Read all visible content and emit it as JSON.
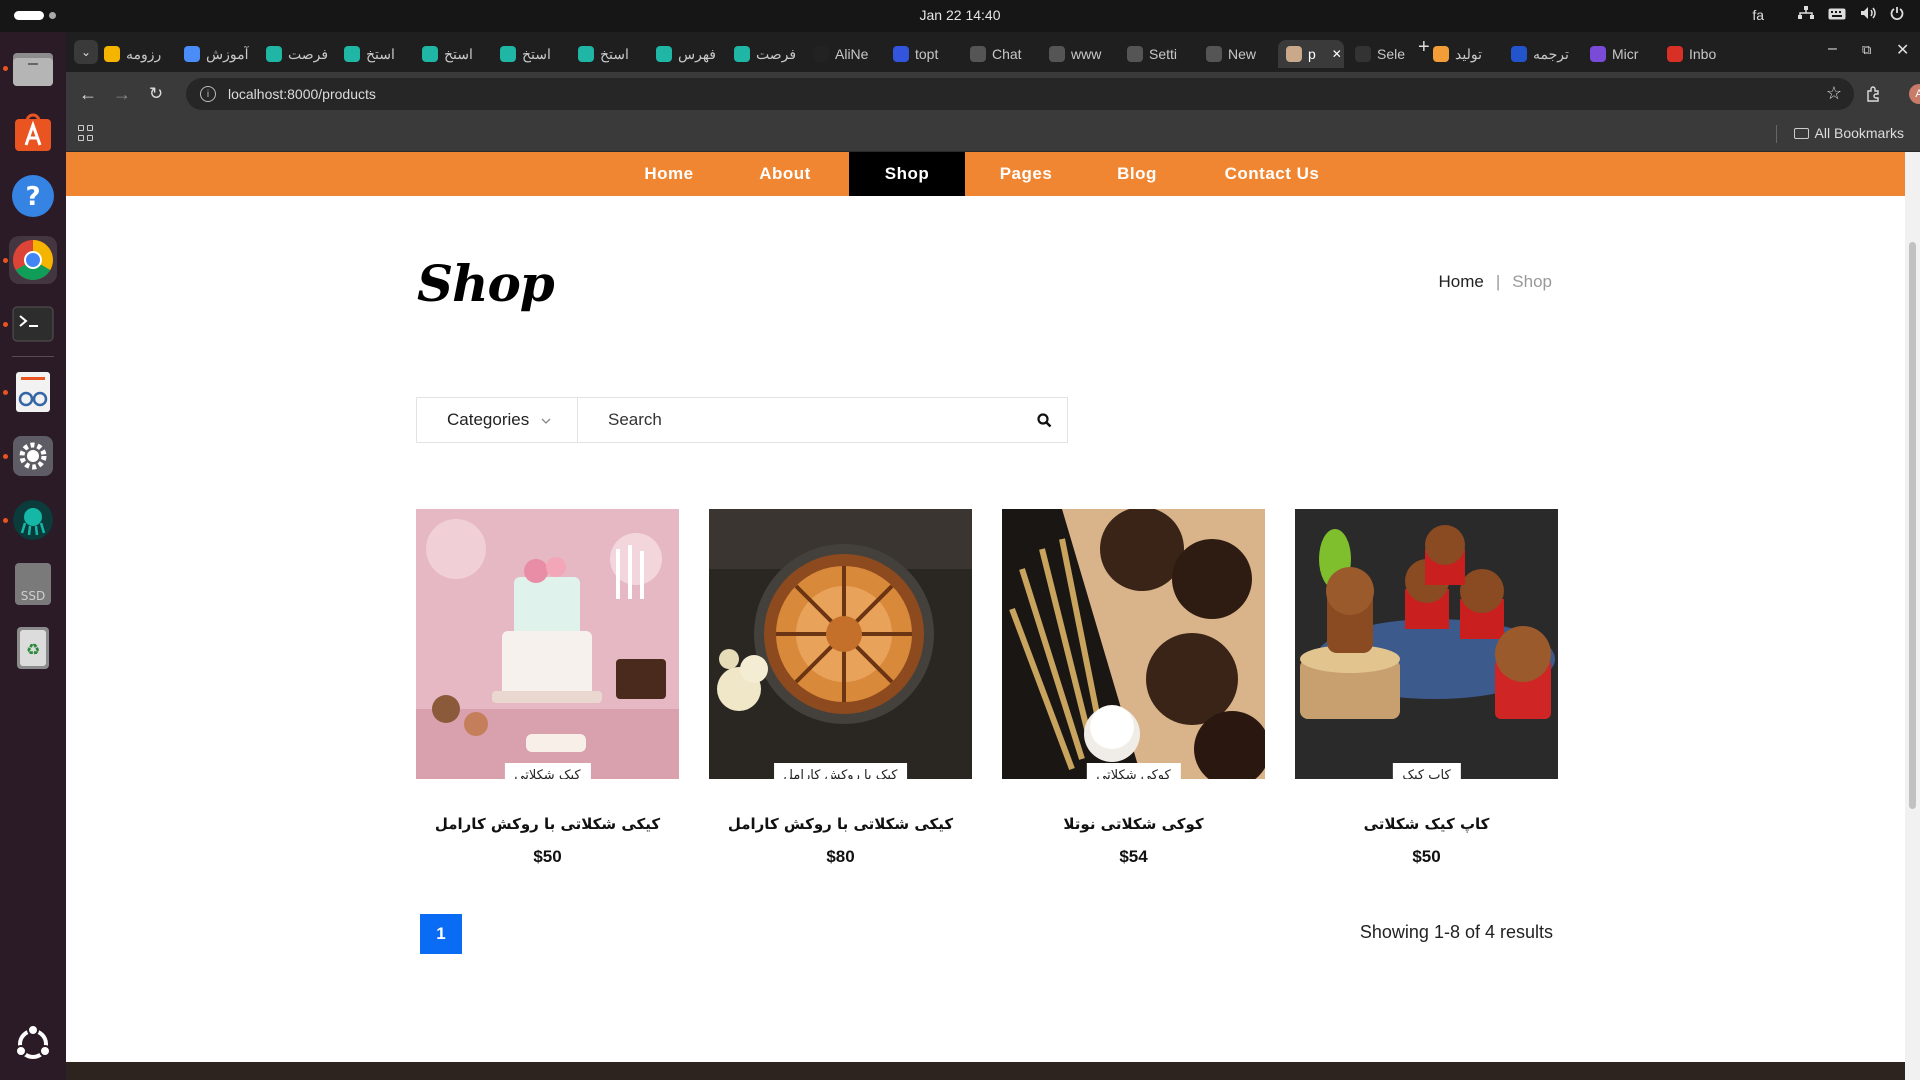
{
  "topbar": {
    "clock": "Jan 22  14:40",
    "lang": "fa"
  },
  "browser": {
    "tabs": [
      {
        "label": "رزومه",
        "color": "#f4b400"
      },
      {
        "label": "آموزش",
        "color": "#4b8df8"
      },
      {
        "label": "فرصت",
        "color": "#1fb6a6"
      },
      {
        "label": "استخ",
        "color": "#1fb6a6"
      },
      {
        "label": "استخ",
        "color": "#1fb6a6"
      },
      {
        "label": "استخ",
        "color": "#1fb6a6"
      },
      {
        "label": "استخ",
        "color": "#1fb6a6"
      },
      {
        "label": "فهرس",
        "color": "#1fb6a6"
      },
      {
        "label": "فرصت",
        "color": "#1fb6a6"
      },
      {
        "label": "AliNe",
        "color": "#222222"
      },
      {
        "label": "topt",
        "color": "#3355dd"
      },
      {
        "label": "Chat",
        "color": "#555555"
      },
      {
        "label": "www",
        "color": "#555555"
      },
      {
        "label": "Setti",
        "color": "#555555"
      },
      {
        "label": "New",
        "color": "#555555"
      },
      {
        "label": "p",
        "color": "#c9a98a"
      },
      {
        "label": "Sele",
        "color": "#333333"
      },
      {
        "label": "تولید",
        "color": "#f29d38"
      },
      {
        "label": "ترجمه",
        "color": "#2255cc"
      },
      {
        "label": "Micr",
        "color": "#7a4bd8"
      },
      {
        "label": "Inbo",
        "color": "#d93025"
      }
    ],
    "url": "localhost:8000/products",
    "all_bookmarks": "All Bookmarks"
  },
  "site": {
    "nav": [
      "Home",
      "About",
      "Shop",
      "Pages",
      "Blog",
      "Contact Us"
    ],
    "page_title": "Shop",
    "breadcrumb": {
      "home": "Home",
      "sep": "|",
      "current": "Shop"
    },
    "filter": {
      "categories": "Categories",
      "search_placeholder": "Search"
    },
    "products": [
      {
        "tag": "کیک شکلاتی",
        "name": "کیکی شکلاتی با روکش کارامل",
        "price": "$50"
      },
      {
        "tag": "کیک با روکش کارامل",
        "name": "کیکی شکلاتی با روکش کارامل",
        "price": "$80"
      },
      {
        "tag": "کوکی شکلاتی",
        "name": "کوکی شکلاتی نوتلا",
        "price": "$54"
      },
      {
        "tag": "کاپ کیک",
        "name": "کاپ کیک شکلاتی",
        "price": "$50"
      }
    ],
    "page_number": "1",
    "results": "Showing 1-8 of 4 results"
  },
  "colors": {
    "nav_orange": "#f08632",
    "nav_active": "#000000",
    "pager_blue": "#0a6cf5"
  }
}
